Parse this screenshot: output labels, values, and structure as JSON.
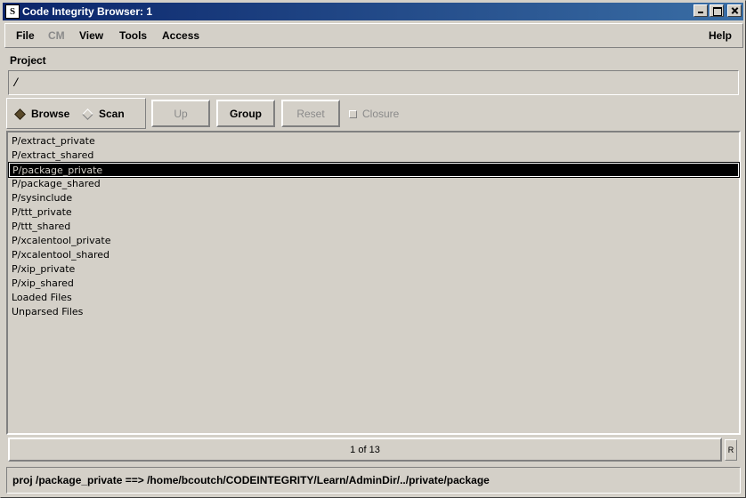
{
  "window": {
    "title": "Code Integrity Browser: 1",
    "icon_name": "app-s-icon",
    "icon_glyph": "S"
  },
  "menu": {
    "file": "File",
    "cm": "CM",
    "view": "View",
    "tools": "Tools",
    "access": "Access",
    "help": "Help"
  },
  "project": {
    "label": "Project",
    "value": "/"
  },
  "toolbar": {
    "browse": "Browse",
    "scan": "Scan",
    "mode_selected": "Browse",
    "up": "Up",
    "group": "Group",
    "reset": "Reset",
    "closure": "Closure"
  },
  "list": {
    "items": [
      "P/extract_private",
      "P/extract_shared",
      "P/package_private",
      "P/package_shared",
      "P/sysinclude",
      "P/ttt_private",
      "P/ttt_shared",
      "P/xcalentool_private",
      "P/xcalentool_shared",
      "P/xip_private",
      "P/xip_shared",
      "Loaded Files",
      "Unparsed Files"
    ],
    "selected_index": 2
  },
  "pager": {
    "text": "1 of 13",
    "corner": "R"
  },
  "status": {
    "text": "proj /package_private ==> /home/bcoutch/CODEINTEGRITY/Learn/AdminDir/../private/package"
  },
  "colors": {
    "titlebar_start": "#0a246a",
    "titlebar_end": "#3a6ea5",
    "background": "#d4d0c8",
    "selection": "#000000"
  }
}
